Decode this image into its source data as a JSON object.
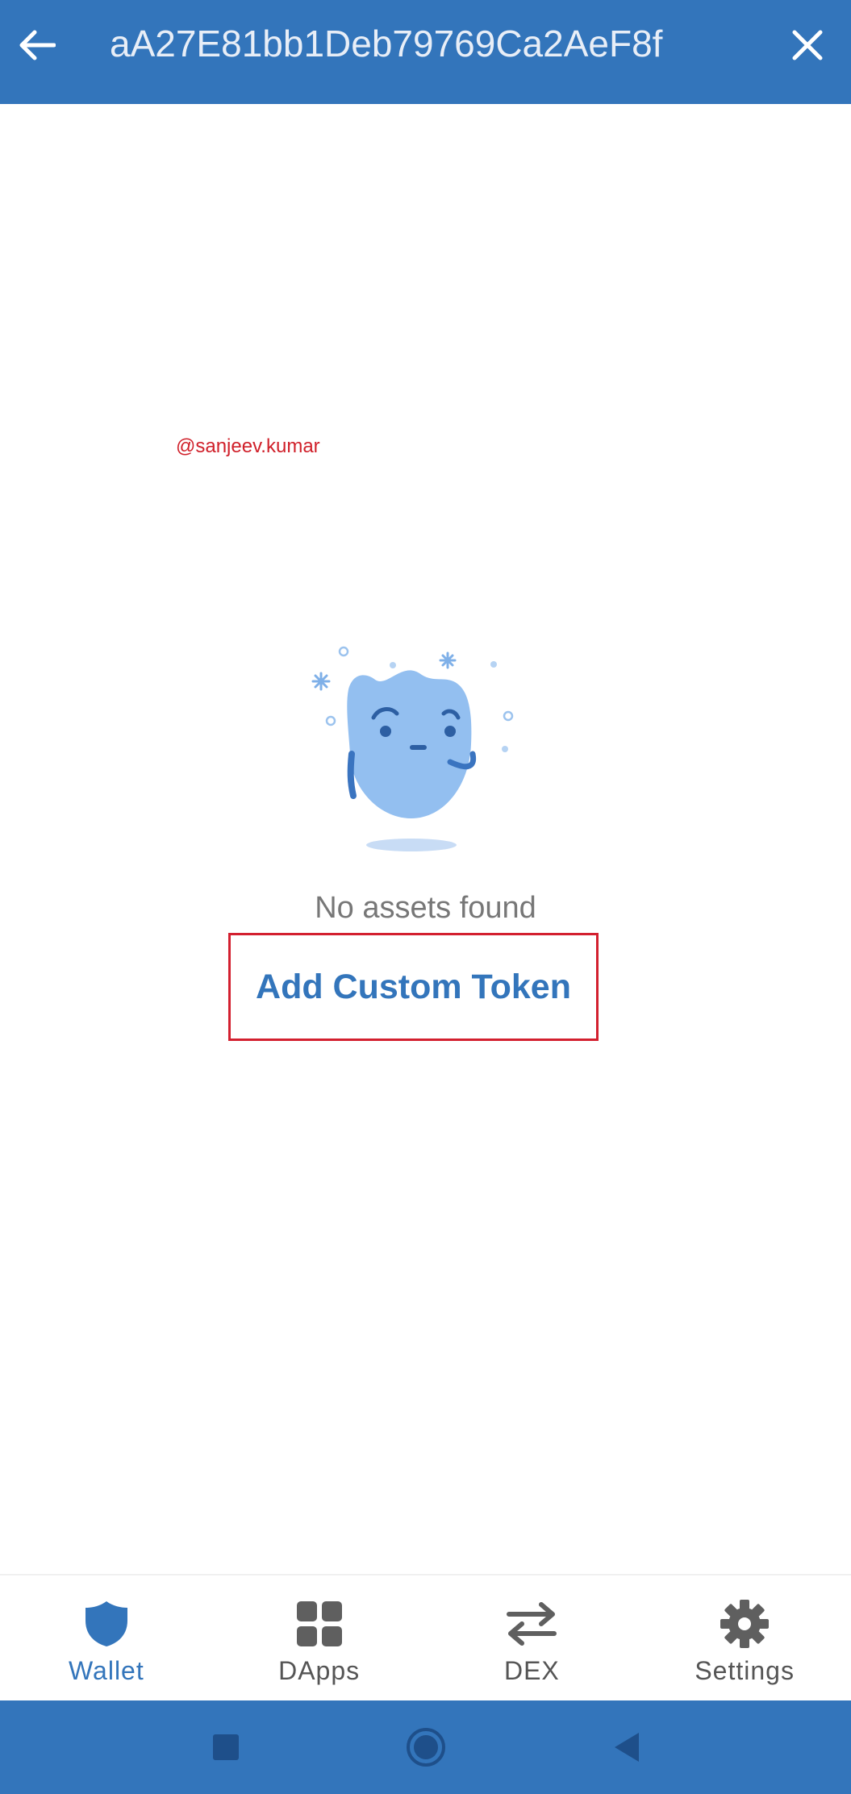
{
  "header": {
    "title": "aA27E81bb1Deb79769Ca2AeF8f",
    "back_icon": "arrow-left-icon",
    "close_icon": "close-icon"
  },
  "watermark": "@sanjeev.kumar",
  "empty_state": {
    "message": "No assets found",
    "action_label": "Add Custom Token"
  },
  "bottom_nav": {
    "items": [
      {
        "label": "Wallet",
        "icon": "shield-icon",
        "active": true
      },
      {
        "label": "DApps",
        "icon": "grid-icon",
        "active": false
      },
      {
        "label": "DEX",
        "icon": "swap-arrows-icon",
        "active": false
      },
      {
        "label": "Settings",
        "icon": "gear-icon",
        "active": false
      }
    ]
  },
  "colors": {
    "primary": "#3375bb",
    "highlight_border": "#d3202f",
    "muted_text": "#777777"
  }
}
